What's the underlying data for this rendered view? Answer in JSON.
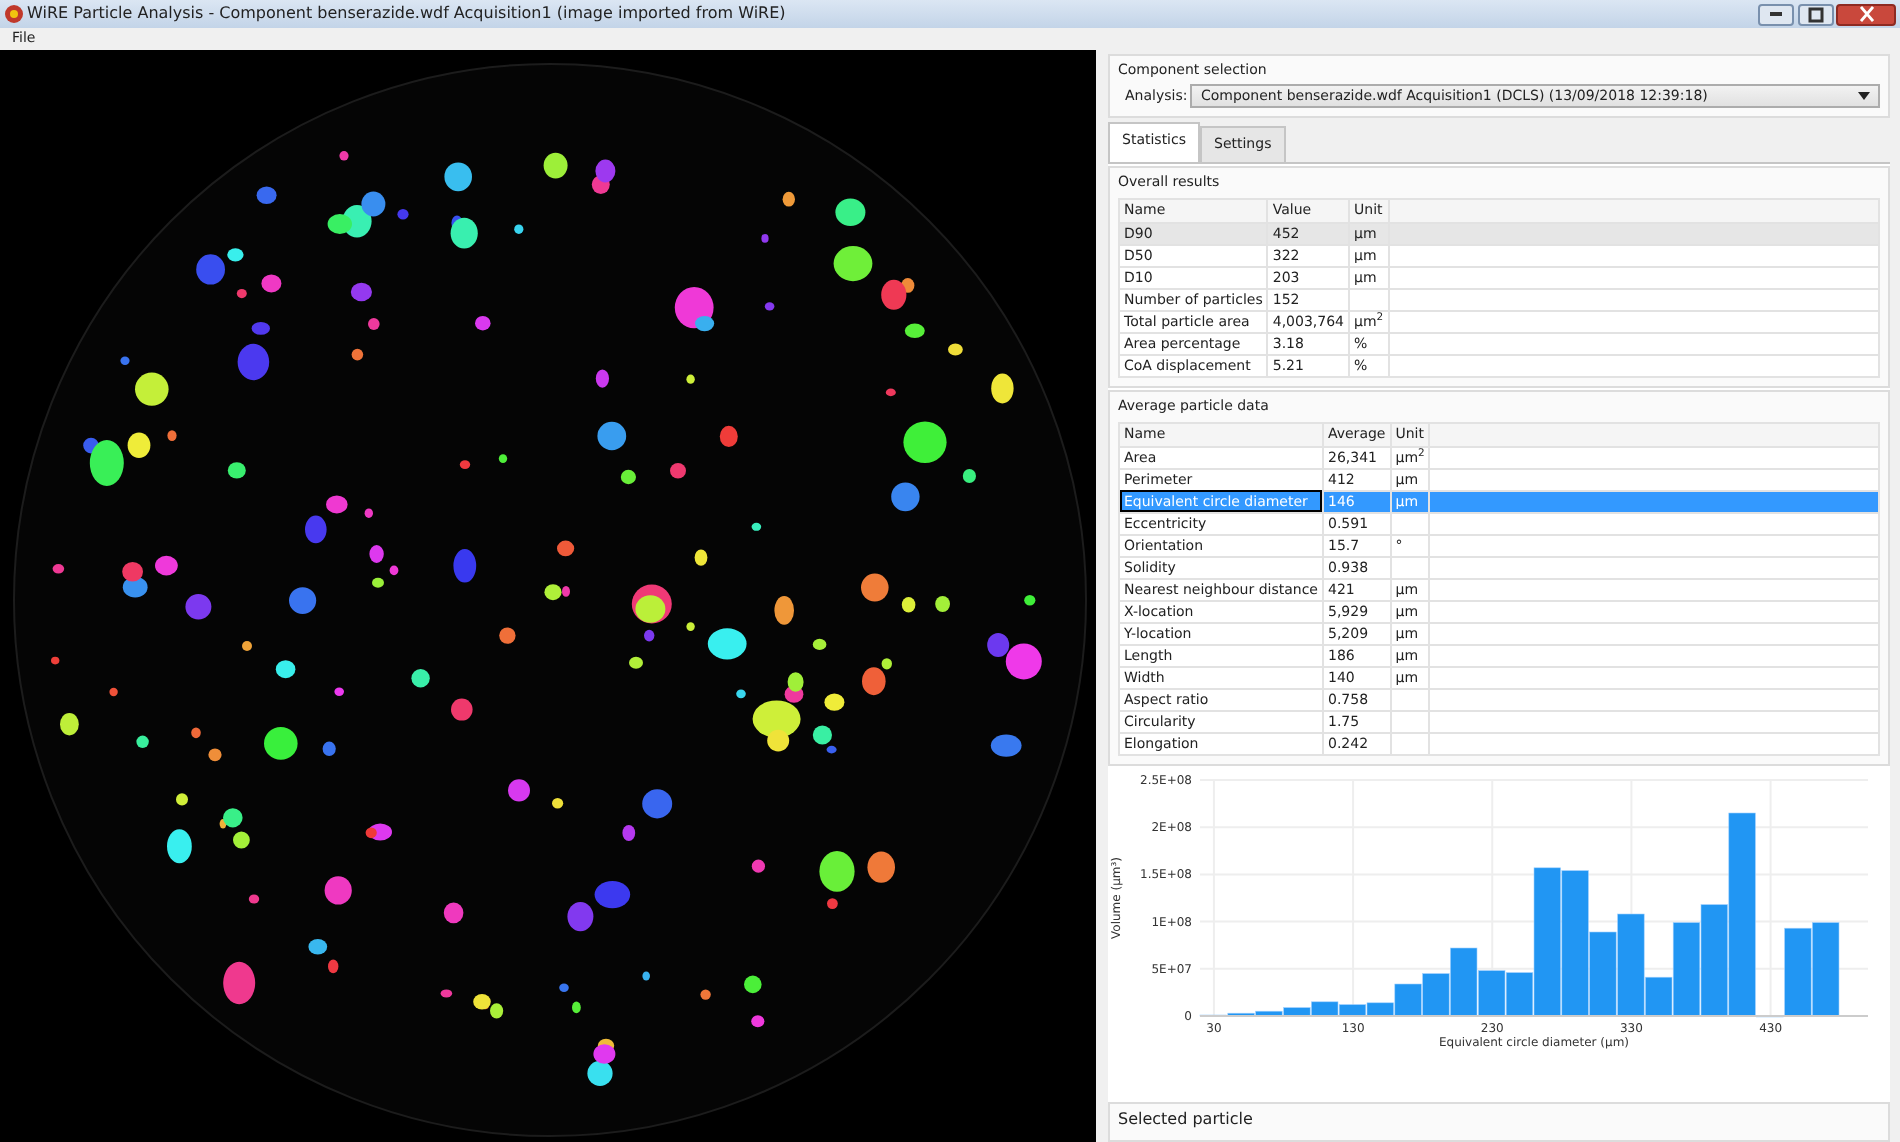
{
  "window": {
    "title": "WiRE Particle Analysis - Component benserazide.wdf Acquisition1 (image imported from WiRE)"
  },
  "menu": [
    "File"
  ],
  "component_selection": {
    "title": "Component selection",
    "analysis_label": "Analysis:",
    "analysis_value": "Component benserazide.wdf Acquisition1 (DCLS) (13/09/2018 12:39:18)"
  },
  "tabs": [
    {
      "label": "Statistics",
      "selected": true
    },
    {
      "label": "Settings",
      "selected": false
    }
  ],
  "overall_results": {
    "title": "Overall results",
    "focused": false,
    "columns": [
      "Name",
      "Value",
      "Unit"
    ],
    "rows": [
      {
        "cells": [
          "D90",
          "452",
          "µm"
        ],
        "selected": true
      },
      {
        "cells": [
          "D50",
          "322",
          "µm"
        ],
        "selected": false
      },
      {
        "cells": [
          "D10",
          "203",
          "µm"
        ],
        "selected": false
      },
      {
        "cells": [
          "Number of particles",
          "152",
          ""
        ],
        "selected": false
      },
      {
        "cells": [
          "Total particle area",
          "4,003,764",
          "µm$^{2}$"
        ],
        "selected": false
      },
      {
        "cells": [
          "Area percentage",
          "3.18",
          "%"
        ],
        "selected": false
      },
      {
        "cells": [
          "CoA displacement",
          "5.21",
          "%"
        ],
        "selected": false
      }
    ]
  },
  "average_particle_data": {
    "title": "Average particle data",
    "focused": true,
    "columns": [
      "Name",
      "Average",
      "Unit"
    ],
    "rows": [
      {
        "cells": [
          "Area",
          "26,341",
          "µm$^{2}$"
        ],
        "selected": false
      },
      {
        "cells": [
          "Perimeter",
          "412",
          "µm"
        ],
        "selected": false
      },
      {
        "cells": [
          "Equivalent circle diameter",
          "146",
          "µm"
        ],
        "selected": true
      },
      {
        "cells": [
          "Eccentricity",
          "0.591",
          ""
        ],
        "selected": false
      },
      {
        "cells": [
          "Orientation",
          "15.7",
          "°"
        ],
        "selected": false
      },
      {
        "cells": [
          "Solidity",
          "0.938",
          ""
        ],
        "selected": false
      },
      {
        "cells": [
          "Nearest neighbour distance",
          "421",
          "µm"
        ],
        "selected": false
      },
      {
        "cells": [
          "X-location",
          "5,929",
          "µm"
        ],
        "selected": false
      },
      {
        "cells": [
          "Y-location",
          "5,209",
          "µm"
        ],
        "selected": false
      },
      {
        "cells": [
          "Length",
          "186",
          "µm"
        ],
        "selected": false
      },
      {
        "cells": [
          "Width",
          "140",
          "µm"
        ],
        "selected": false
      },
      {
        "cells": [
          "Aspect ratio",
          "0.758",
          ""
        ],
        "selected": false
      },
      {
        "cells": [
          "Circularity",
          "1.75",
          ""
        ],
        "selected": false
      },
      {
        "cells": [
          "Elongation",
          "0.242",
          ""
        ],
        "selected": false
      }
    ]
  },
  "histogram": {
    "chart_data": {
      "type": "bar",
      "xlabel": "Equivalent circle diameter (µm)",
      "ylabel": "Volume (µm³)",
      "x": [
        30,
        50,
        70,
        90,
        110,
        130,
        150,
        170,
        190,
        210,
        230,
        250,
        270,
        290,
        310,
        330,
        350,
        370,
        390,
        410,
        430,
        450,
        470
      ],
      "grid": true,
      "series": [
        {
          "color": "#2196f3",
          "values": [
            1000000,
            3000000,
            5000000,
            9000000,
            15000000,
            12000000,
            14000000,
            34000000,
            45000000,
            72000000,
            48000000,
            46000000,
            157000000,
            154000000,
            89000000,
            108000000,
            41000000,
            99000000,
            118000000,
            215000000,
            0,
            93000000,
            99000000
          ]
        }
      ],
      "xlim": [
        20,
        500
      ],
      "ylim": [
        0,
        250000000
      ],
      "xticks": [
        30,
        130,
        230,
        330,
        430
      ],
      "yticks": [
        {
          "value": 0,
          "label": "0"
        },
        {
          "value": 50000000,
          "label": "5E+07"
        },
        {
          "value": 100000000,
          "label": "1E+08"
        },
        {
          "value": 150000000,
          "label": "1.5E+08"
        },
        {
          "value": 200000000,
          "label": "2E+08"
        },
        {
          "value": 250000000,
          "label": "2.5E+08"
        }
      ]
    }
  },
  "selected_particle": {
    "title": "Selected particle"
  }
}
